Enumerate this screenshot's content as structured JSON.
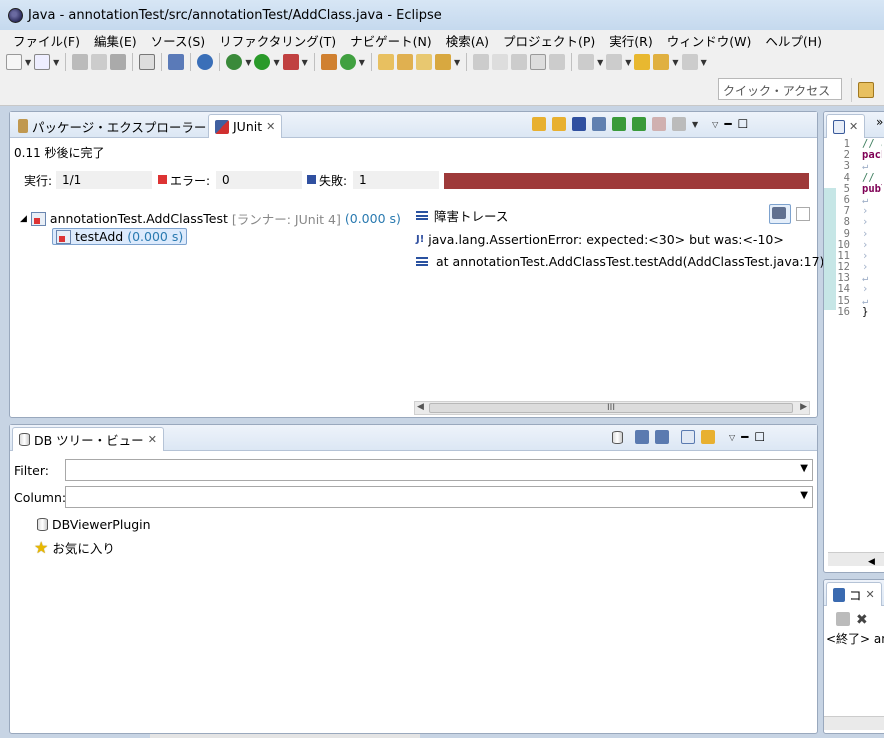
{
  "window": {
    "title": "Java - annotationTest/src/annotationTest/AddClass.java - Eclipse"
  },
  "menu": [
    "ファイル(F)",
    "編集(E)",
    "ソース(S)",
    "リファクタリング(T)",
    "ナビゲート(N)",
    "検索(A)",
    "プロジェクト(P)",
    "実行(R)",
    "ウィンドウ(W)",
    "ヘルプ(H)"
  ],
  "toolbar": {
    "quick_access": "クイック・アクセス"
  },
  "top_view": {
    "tabs": [
      {
        "label": "パッケージ・エクスプローラー"
      },
      {
        "label": "JUnit"
      }
    ],
    "status": "0.11 秒後に完了",
    "counters": {
      "runs_label": "実行:",
      "runs_value": "1/1",
      "errors_label": "エラー:",
      "errors_value": "0",
      "failures_label": "失敗:",
      "failures_value": "1"
    },
    "progress": {
      "fraction": 1.0,
      "color": "#9e3a3a"
    },
    "tree": {
      "root": {
        "name": "annotationTest.AddClassTest",
        "runner": "[ランナー: JUnit 4]",
        "time": "(0.000 s)"
      },
      "child": {
        "name": "testAdd",
        "time": "(0.000 s)"
      }
    },
    "trace": {
      "header": "障害トレース",
      "lines": [
        "java.lang.AssertionError: expected:<30> but was:<-10>",
        "at annotationTest.AddClassTest.testAdd(AddClassTest.java:17)"
      ],
      "scroll_label": "III"
    }
  },
  "db_view": {
    "tab_label": "DB ツリー・ビュー",
    "filter_label": "Filter:",
    "column_label": "Column:",
    "items": [
      "DBViewerPlugin",
      "お気に入り"
    ]
  },
  "editor": {
    "overflow_label": "»",
    "lines": [
      {
        "n": "1",
        "code": "// a",
        "kind": "cmt"
      },
      {
        "n": "2",
        "code": "pack",
        "kind": "kw"
      },
      {
        "n": "3",
        "code": "↵",
        "kind": "ret"
      },
      {
        "n": "4",
        "code": "// カ",
        "kind": "cmt"
      },
      {
        "n": "5",
        "code": "publ",
        "kind": "kw"
      },
      {
        "n": "6",
        "code": "↵",
        "kind": "ret"
      },
      {
        "n": "7",
        "code": "›",
        "kind": "ret"
      },
      {
        "n": "8",
        "code": "›",
        "kind": "ret"
      },
      {
        "n": "9",
        "code": "›",
        "kind": "ret"
      },
      {
        "n": "10",
        "code": "›",
        "kind": "ret"
      },
      {
        "n": "11",
        "code": "›",
        "kind": "ret"
      },
      {
        "n": "12",
        "code": "›",
        "kind": "ret"
      },
      {
        "n": "13",
        "code": "↵",
        "kind": "ret"
      },
      {
        "n": "14",
        "code": "›",
        "kind": "ret"
      },
      {
        "n": "15",
        "code": "↵",
        "kind": "ret"
      },
      {
        "n": "16",
        "code": "}",
        "kind": "plain"
      }
    ]
  },
  "console": {
    "tab_label": "コ",
    "text": "<終了> an"
  }
}
